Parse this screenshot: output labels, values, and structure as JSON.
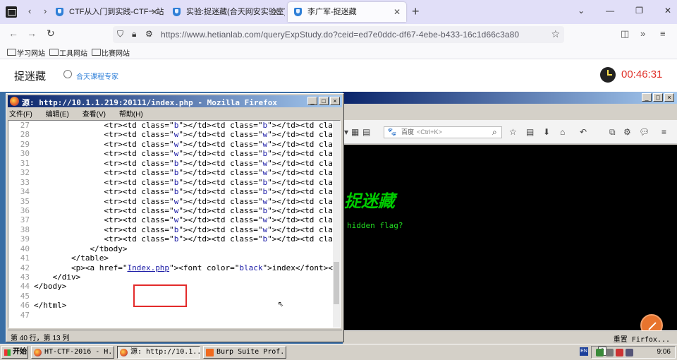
{
  "browser": {
    "tabs": [
      {
        "label": "CTF从入门到实践-CTF一站式学"
      },
      {
        "label": "实验:捉迷藏(合天网安实验室)"
      },
      {
        "label": "李广军-捉迷藏"
      }
    ],
    "url": "https://www.hetianlab.com/queryExpStudy.do?ceid=ed7e0ddc-df67-4ebe-b433-16c1d66c3a80",
    "bookmarks": [
      "学习网站",
      "工具网站",
      "比赛网站"
    ]
  },
  "page": {
    "title": "捉迷藏",
    "expert_label": "合天课程专家",
    "timer": "00:46:31"
  },
  "source_window": {
    "title": "源: http://10.1.1.219:20111/index.php - Mozilla Firefox",
    "menu": [
      "文件(F)",
      "编辑(E)",
      "查看(V)",
      "帮助(H)"
    ],
    "status": "第 40 行，第 13 列",
    "lines": [
      {
        "n": "27",
        "ind": 6,
        "cls": [
          "b",
          "b",
          "b"
        ]
      },
      {
        "n": "28",
        "ind": 6,
        "cls": [
          "w",
          "w",
          "w"
        ]
      },
      {
        "n": "29",
        "ind": 6,
        "cls": [
          "w",
          "w",
          "w"
        ]
      },
      {
        "n": "30",
        "ind": 6,
        "cls": [
          "w",
          "b",
          "w"
        ]
      },
      {
        "n": "31",
        "ind": 6,
        "cls": [
          "b",
          "w",
          "w"
        ]
      },
      {
        "n": "32",
        "ind": 6,
        "cls": [
          "b",
          "w",
          "w"
        ]
      },
      {
        "n": "33",
        "ind": 6,
        "cls": [
          "b",
          "b",
          "w"
        ]
      },
      {
        "n": "34",
        "ind": 6,
        "cls": [
          "b",
          "b",
          "b"
        ]
      },
      {
        "n": "35",
        "ind": 6,
        "cls": [
          "w",
          "w",
          "w"
        ]
      },
      {
        "n": "36",
        "ind": 6,
        "cls": [
          "w",
          "b",
          "w"
        ]
      },
      {
        "n": "37",
        "ind": 6,
        "cls": [
          "w",
          "w",
          "w"
        ]
      },
      {
        "n": "38",
        "ind": 6,
        "cls": [
          "b",
          "w",
          "w"
        ]
      },
      {
        "n": "39",
        "ind": 6,
        "cls": [
          "b",
          "b",
          "b"
        ]
      }
    ],
    "tail_lines": [
      {
        "n": "40",
        "text": "            </tbody>"
      },
      {
        "n": "41",
        "text": "        </table>"
      },
      {
        "n": "42",
        "text": "        <p><a href=\"Index.php\"><font color=\"black\">index</font></"
      },
      {
        "n": "43",
        "text": "    </div>"
      },
      {
        "n": "44",
        "text": "</body>"
      },
      {
        "n": "45",
        "text": ""
      },
      {
        "n": "46",
        "text": "</html>"
      },
      {
        "n": "47",
        "text": ""
      }
    ],
    "link_text": "Index.php",
    "font_color_value": "black",
    "index_text": "index"
  },
  "back_window": {
    "search_engine": "百度",
    "search_hint": "<Ctrl+K>",
    "logo_text": "捉迷藏",
    "hidden_flag_text": "hidden flag?",
    "status_reset": "重置 Firfox..."
  },
  "taskbar": {
    "start": "开始",
    "tasks": [
      "HT-CTF-2016 - H...",
      "源: http://10.1....",
      "Burp Suite Prof..."
    ],
    "lang": "EN",
    "clock": "9:06"
  },
  "colors": {
    "accent_blue": "#2e7fd8",
    "timer_red": "#e0322a",
    "highlight_red": "#e32b2b",
    "flag_green": "#22dd22"
  }
}
